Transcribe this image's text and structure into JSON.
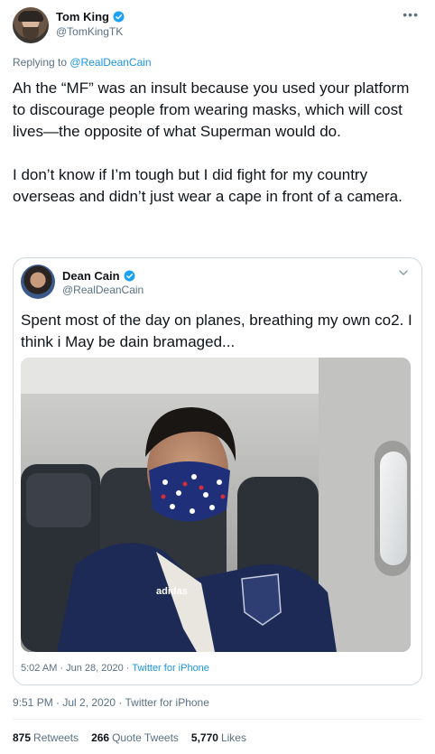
{
  "author": {
    "name": "Tom King",
    "handle": "@TomKingTK",
    "verified_color": "#1da1f2"
  },
  "more_icon": "more-horizontal-icon",
  "reply": {
    "prefix": "Replying to ",
    "target": "@RealDeanCain"
  },
  "text": {
    "paragraph1": "Ah the “MF” was an insult because you used your platform to discourage people from wearing masks, which will cost lives—the opposite of what Superman would do.",
    "paragraph2": "I don’t know if I’m tough but I did  fight for my country overseas and didn’t just wear a cape in front of a camera."
  },
  "quoted": {
    "name": "Dean Cain",
    "handle": "@RealDeanCain",
    "text": "Spent most of the day on planes, breathing my own co2.  I think i May be dain bramaged...",
    "date": "5:02 AM · Jun 28, 2020 · ",
    "source": "Twitter for iPhone",
    "photo_jacket_brand": "adidas"
  },
  "meta": "9:51 PM · Jul 2, 2020 · Twitter for iPhone",
  "stats": {
    "retweets_count": "875",
    "retweets_label": "Retweets",
    "quotes_count": "266",
    "quotes_label": "Quote Tweets",
    "likes_count": "5,770",
    "likes_label": "Likes"
  }
}
